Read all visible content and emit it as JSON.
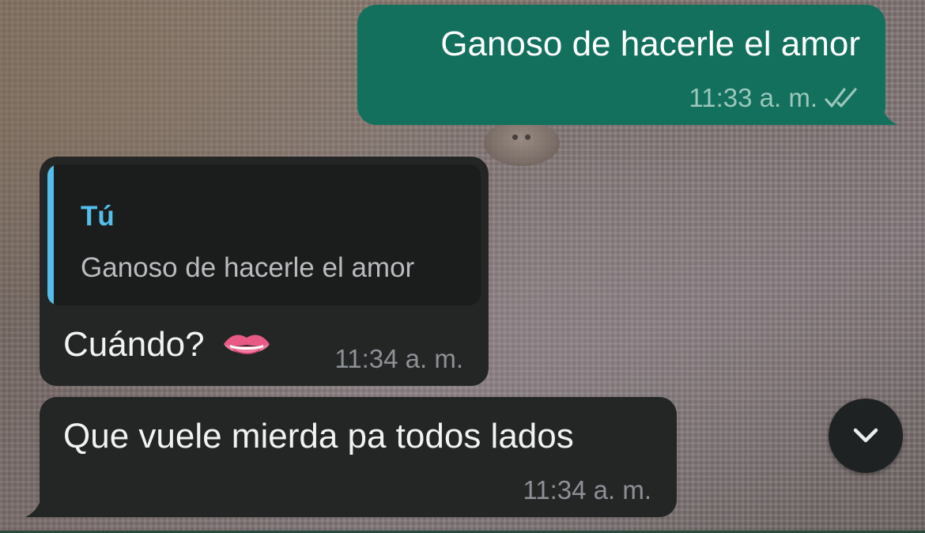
{
  "chat": {
    "messages": [
      {
        "direction": "outgoing",
        "text": "Ganoso de hacerle el amor",
        "time": "11:33 a. m.",
        "status_icon": "double-check-icon"
      },
      {
        "direction": "incoming",
        "reply_to": {
          "author": "Tú",
          "text": "Ganoso de hacerle el amor"
        },
        "text": "Cuándo?",
        "emoji_icon": "biting-lip-emoji",
        "time": "11:34 a. m."
      },
      {
        "direction": "incoming",
        "text": "Que vuele mierda pa todos lados",
        "time": "11:34 a. m."
      }
    ],
    "scroll_button_icon": "chevron-down-icon"
  },
  "colors": {
    "outgoing_bubble": "#12705d",
    "incoming_bubble": "#242626",
    "quote_accent": "#53bdeb",
    "time_outgoing": "#9cc7bb",
    "time_incoming": "#8d9195"
  }
}
